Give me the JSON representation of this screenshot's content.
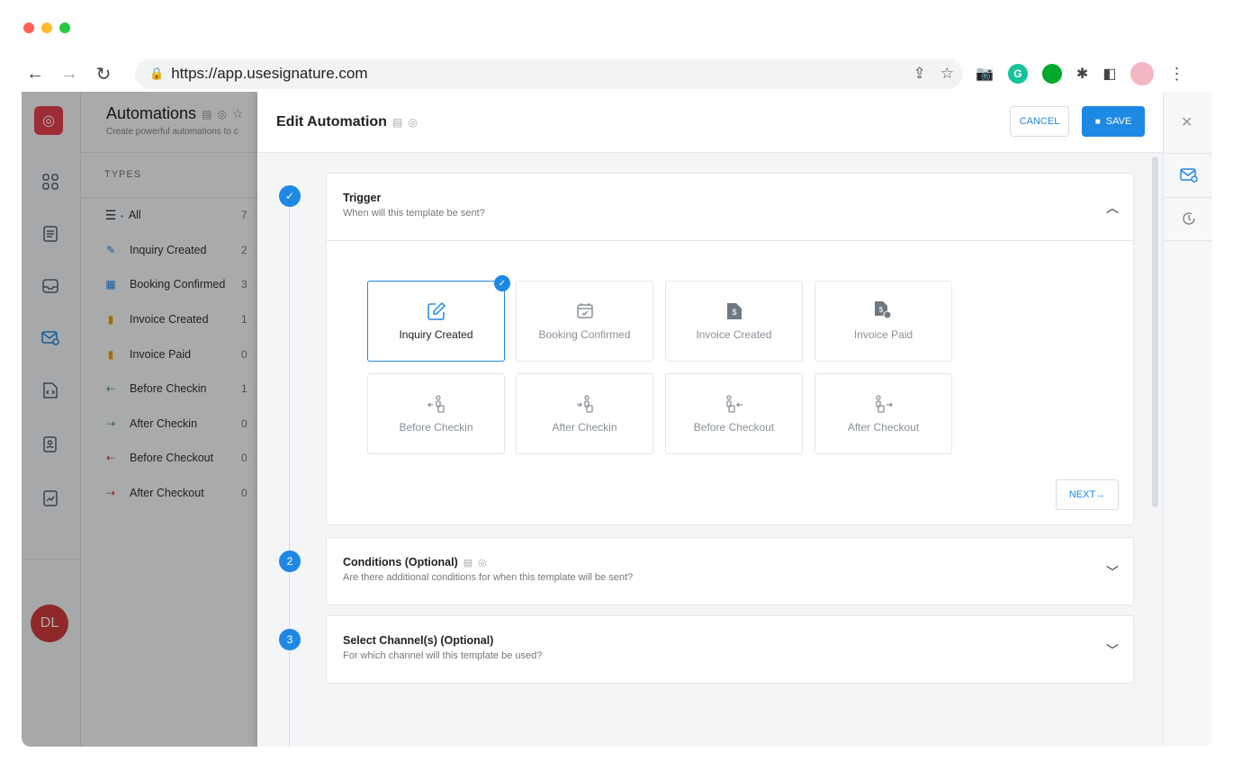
{
  "browser": {
    "url": "https://app.usesignature.com",
    "traffic_colors": [
      "#ff5f57",
      "#febc2e",
      "#28c840"
    ]
  },
  "app": {
    "avatar_initials": "DL",
    "panel": {
      "title": "Automations",
      "subtitle": "Create powerful automations to c",
      "types_label": "TYPES",
      "types": [
        {
          "label": "All",
          "count": "7",
          "icon": "list-icon"
        },
        {
          "label": "Inquiry Created",
          "count": "2",
          "icon": "edit-icon"
        },
        {
          "label": "Booking Confirmed",
          "count": "3",
          "icon": "calendar-check-icon"
        },
        {
          "label": "Invoice Created",
          "count": "1",
          "icon": "invoice-icon"
        },
        {
          "label": "Invoice Paid",
          "count": "0",
          "icon": "invoice-paid-icon"
        },
        {
          "label": "Before Checkin",
          "count": "1",
          "icon": "before-checkin-icon"
        },
        {
          "label": "After Checkin",
          "count": "0",
          "icon": "after-checkin-icon"
        },
        {
          "label": "Before Checkout",
          "count": "0",
          "icon": "before-checkout-icon"
        },
        {
          "label": "After Checkout",
          "count": "0",
          "icon": "after-checkout-icon"
        }
      ]
    },
    "modal": {
      "title": "Edit Automation",
      "cancel_label": "CANCEL",
      "save_label": "SAVE",
      "steps": [
        {
          "number": "1",
          "title": "Trigger",
          "subtitle": "When will this template be sent?",
          "expanded": true
        },
        {
          "number": "2",
          "title": "Conditions (Optional)",
          "subtitle": "Are there additional conditions for when this template will be sent?",
          "expanded": false
        },
        {
          "number": "3",
          "title": "Select Channel(s) (Optional)",
          "subtitle": "For which channel will this template be used?",
          "expanded": false
        }
      ],
      "triggers": [
        {
          "label": "Inquiry Created",
          "selected": true,
          "icon": "edit-icon"
        },
        {
          "label": "Booking Confirmed",
          "selected": false,
          "icon": "calendar-check-icon"
        },
        {
          "label": "Invoice Created",
          "selected": false,
          "icon": "invoice-icon"
        },
        {
          "label": "Invoice Paid",
          "selected": false,
          "icon": "invoice-paid-icon"
        },
        {
          "label": "Before Checkin",
          "selected": false,
          "icon": "before-checkin-icon"
        },
        {
          "label": "After Checkin",
          "selected": false,
          "icon": "after-checkin-icon"
        },
        {
          "label": "Before Checkout",
          "selected": false,
          "icon": "before-checkout-icon"
        },
        {
          "label": "After Checkout",
          "selected": false,
          "icon": "after-checkout-icon"
        }
      ],
      "next_label": "NEXT→"
    },
    "colors": {
      "accent": "#1e88e5",
      "brand": "#e8434f",
      "avatar": "#d33d3d"
    }
  }
}
